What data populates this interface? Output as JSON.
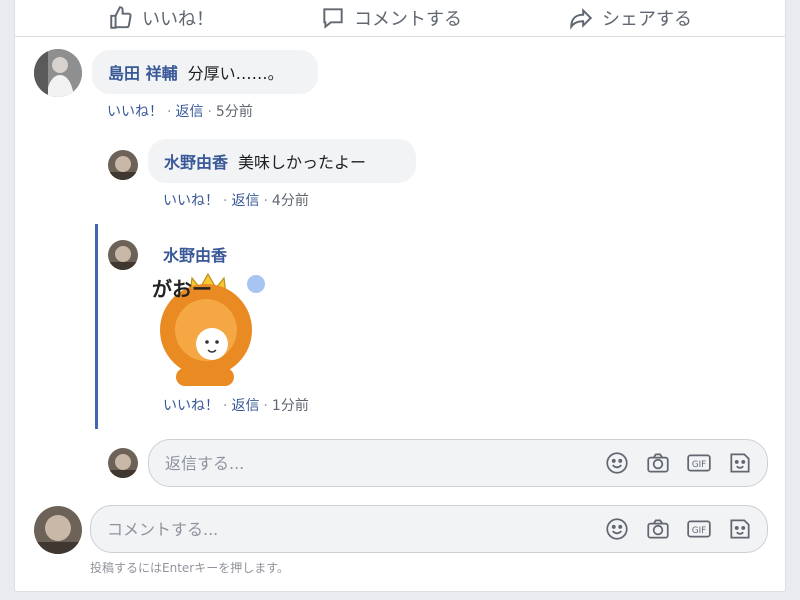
{
  "actions": {
    "like": "いいね！",
    "comment": "コメントする",
    "share": "シェアする"
  },
  "comments": [
    {
      "author": "島田 祥輔",
      "text": "分厚い……。",
      "like": "いいね！",
      "reply": "返信",
      "sep": "·",
      "time": "5分前"
    }
  ],
  "replies": [
    {
      "author": "水野由香",
      "text": "美味しかったよー",
      "like": "いいね！",
      "reply": "返信",
      "sep": "·",
      "time": "4分前"
    },
    {
      "author": "水野由香",
      "sticker": "lion-sticker",
      "sticker_text": "がおー",
      "like": "いいね！",
      "reply": "返信",
      "sep": "·",
      "time": "1分前"
    }
  ],
  "reply_input": {
    "placeholder": "返信する..."
  },
  "comment_input": {
    "placeholder": "コメントする..."
  },
  "input_icons": [
    "emoji-icon",
    "camera-icon",
    "gif-icon",
    "sticker-icon"
  ],
  "gif_label": "GIF",
  "hint": "投稿するにはEnterキーを押します。",
  "colors": {
    "link": "#385898",
    "bubble": "#f2f3f5",
    "thread": "#4267b2"
  }
}
